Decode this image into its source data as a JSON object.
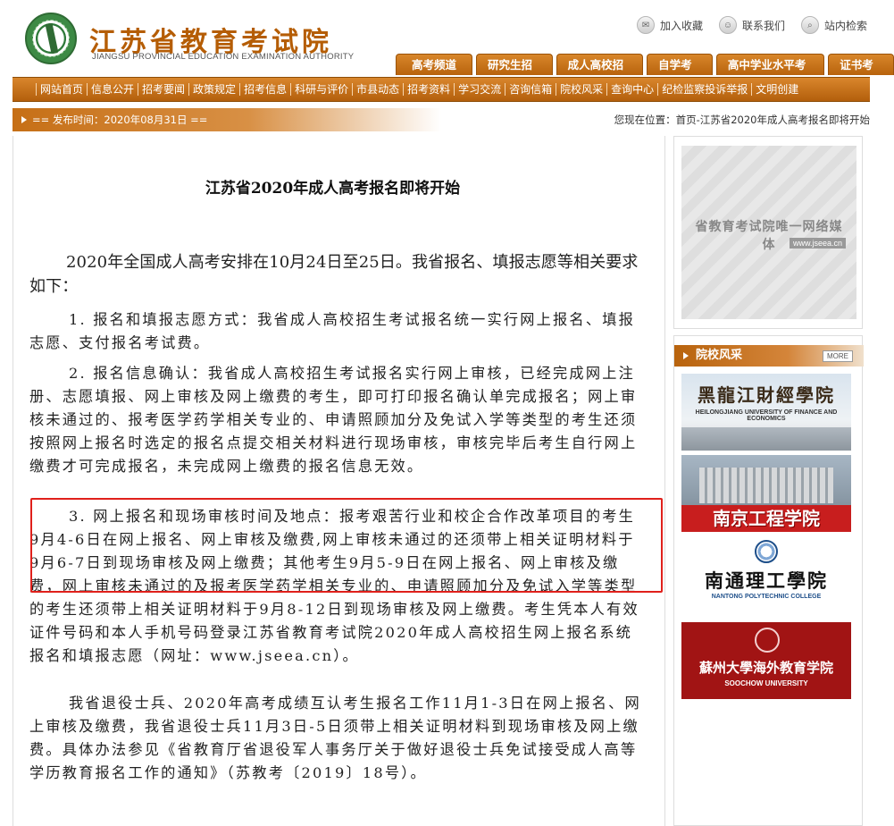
{
  "header": {
    "site_title": "江苏省教育考试院",
    "site_subtitle": "JIANGSU PROVINCIAL EDUCATION EXAMINATION AUTHORITY",
    "top_links": [
      {
        "label": "加入收藏",
        "icon": "bookmark-icon"
      },
      {
        "label": "联系我们",
        "icon": "contact-icon"
      },
      {
        "label": "站内检索",
        "icon": "search-icon"
      }
    ],
    "tabs": [
      "高考频道",
      "研究生招生",
      "成人高校招生",
      "自学考试",
      "高中学业水平考试",
      "证书考试"
    ]
  },
  "nav": {
    "items": [
      "网站首页",
      "信息公开",
      "招考要闻",
      "政策规定",
      "招考信息",
      "科研与评价",
      "市县动态",
      "招考资料",
      "学习交流",
      "咨询信箱",
      "院校风采",
      "查询中心",
      "纪检监察投诉举报",
      "文明创建"
    ]
  },
  "info_bar": {
    "publish_time": "== 发布时间：2020年08月31日 ==",
    "location": "您现在位置：首页-江苏省2020年成人高考报名即将开始"
  },
  "article": {
    "title": "江苏省2020年成人高考报名即将开始",
    "lead": "2020年全国成人高考安排在10月24日至25日。我省报名、填报志愿等相关要求如下：",
    "p1": "1. 报名和填报志愿方式：我省成人高校招生考试报名统一实行网上报名、填报志愿、支付报名考试费。",
    "p2": "2. 报名信息确认：我省成人高校招生考试报名实行网上审核，已经完成网上注册、志愿填报、网上审核及网上缴费的考生，即可打印报名确认单完成报名；网上审核未通过的、报考医学药学相关专业的、申请照顾加分及免试入学等类型的考生还须按照网上报名时选定的报名点提交相关材料进行现场审核，审核完毕后考生自行网上缴费才可完成报名，未完成网上缴费的报名信息无效。",
    "p3": "3. 网上报名和现场审核时间及地点：报考艰苦行业和校企合作改革项目的考生9月4-6日在网上报名、网上审核及缴费,网上审核未通过的还须带上相关证明材料于9月6-7日到现场审核及网上缴费；其他考生9月5-9日在网上报名、网上审核及缴费，网上审核未通过的及报考医学药学相关专业的、申请照顾加分及免试入学等类型的考生还须带上相关证明材料于9月8-12日到现场审核及网上缴费。考生凭本人有效证件号码和本人手机号码登录江苏省教育考试院2020年成人高校招生网上报名系统报名和填报志愿（网址：www.jseea.cn）。",
    "p4": "我省退役士兵、2020年高考成绩互认考生报名工作11月1-3日在网上报名、网上审核及缴费，我省退役士兵11月3日-5日须带上相关证明材料到现场审核及网上缴费。具体办法参见《省教育厅省退役军人事务厅关于做好退役士兵免试接受成人高等学历教育报名工作的通知》（苏教考〔2019〕18号）。"
  },
  "sidebar": {
    "ad": {
      "text": "省教育考试院唯一网络媒体",
      "url": "www.jseea.cn"
    },
    "section_title": "院校风采",
    "more_label": "MORE",
    "schools": [
      {
        "name": "黑龍江財經學院",
        "en": "HEILONGJIANG UNIVERSITY OF FINANCE AND ECONOMICS"
      },
      {
        "name": "南京工程学院",
        "en": ""
      },
      {
        "name": "南通理工學院",
        "en": "NANTONG POLYTECHNIC COLLEGE"
      },
      {
        "name": "蘇州大學海外教育学院",
        "en": "SOOCHOW UNIVERSITY"
      }
    ]
  },
  "colors": {
    "brand_orange": "#b8630d",
    "highlight_red": "#e0201b"
  }
}
